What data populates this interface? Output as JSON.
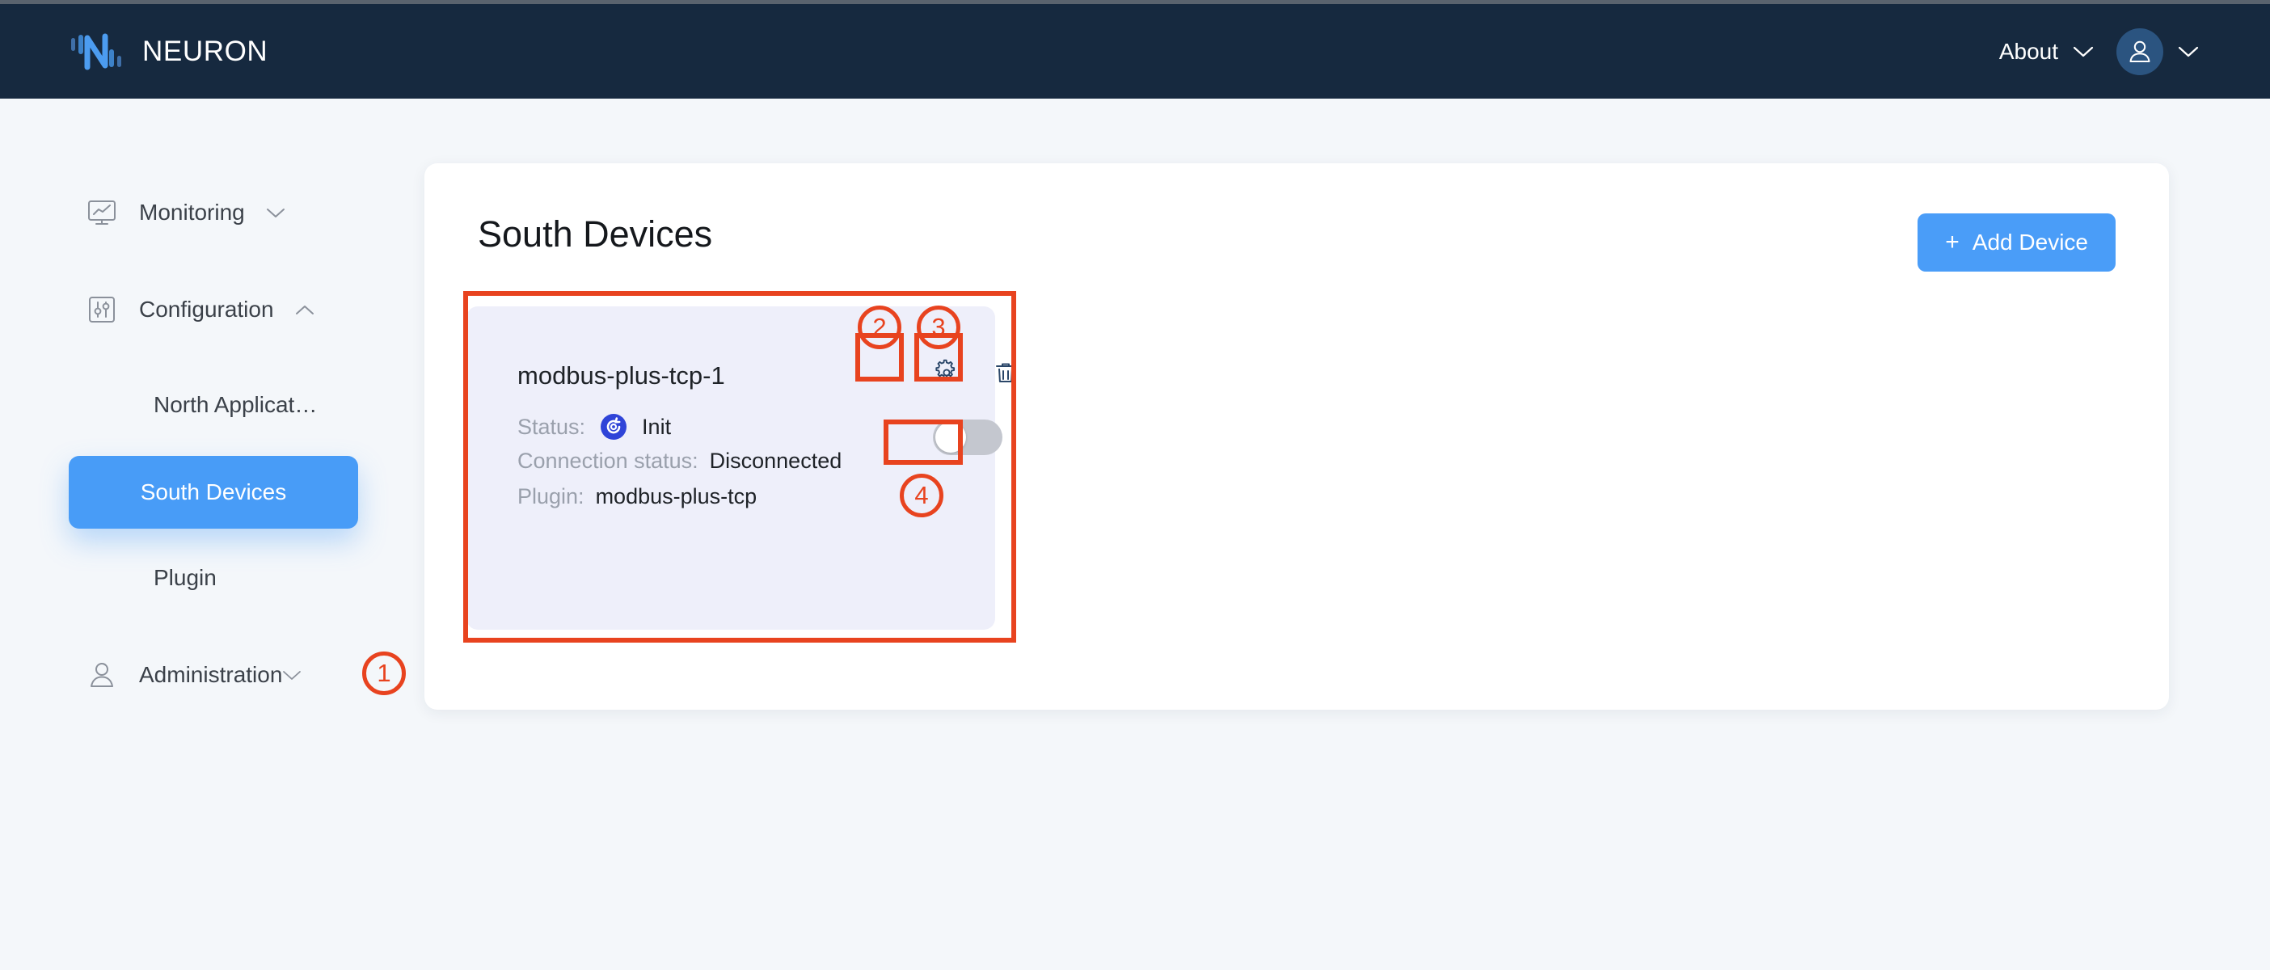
{
  "header": {
    "brand_name": "NEURON",
    "logo_icon": "neuron-logo-icon",
    "about_label": "About",
    "about_chevron_icon": "chevron-down-icon",
    "avatar_icon": "user-avatar-icon",
    "avatar_chevron_icon": "chevron-down-icon"
  },
  "sidebar": {
    "items": [
      {
        "label": "Monitoring",
        "icon": "monitor-chart-icon",
        "chevron": "chevron-down-icon",
        "active": false
      },
      {
        "label": "Configuration",
        "icon": "sliders-square-icon",
        "chevron": "chevron-up-icon",
        "active": false
      },
      {
        "label": "North Applicat…",
        "icon": "",
        "chevron": "",
        "active": false
      },
      {
        "label": "South Devices",
        "icon": "",
        "chevron": "",
        "active": true
      },
      {
        "label": "Plugin",
        "icon": "",
        "chevron": "",
        "active": false
      },
      {
        "label": "Administration",
        "icon": "user-outline-icon",
        "chevron": "chevron-down-icon",
        "active": false
      }
    ]
  },
  "main": {
    "page_title": "South Devices",
    "add_device_label": "Add Device",
    "add_device_plus": "+",
    "device_card": {
      "name": "modbus-plus-tcp-1",
      "gear_icon": "gear-icon",
      "trash_icon": "trash-icon",
      "status_label": "Status:",
      "status_icon": "init-refresh-icon",
      "status_value": "Init",
      "connection_label": "Connection status:",
      "connection_value": "Disconnected",
      "plugin_label": "Plugin:",
      "plugin_value": "modbus-plus-tcp",
      "toggle_state": "off"
    }
  },
  "annotations": {
    "markers": [
      {
        "number": "1",
        "target": "device-card-region"
      },
      {
        "number": "2",
        "target": "gear-button"
      },
      {
        "number": "3",
        "target": "trash-button"
      },
      {
        "number": "4",
        "target": "enable-toggle"
      }
    ],
    "color": "#e8431f"
  },
  "colors": {
    "header_bg": "#16293f",
    "accent_blue": "#489cf7",
    "page_bg": "#f4f7fa",
    "panel_bg": "#ffffff",
    "card_bg": "#eeeffa",
    "annotation_red": "#e8431f",
    "status_blue": "#2f44d8"
  }
}
